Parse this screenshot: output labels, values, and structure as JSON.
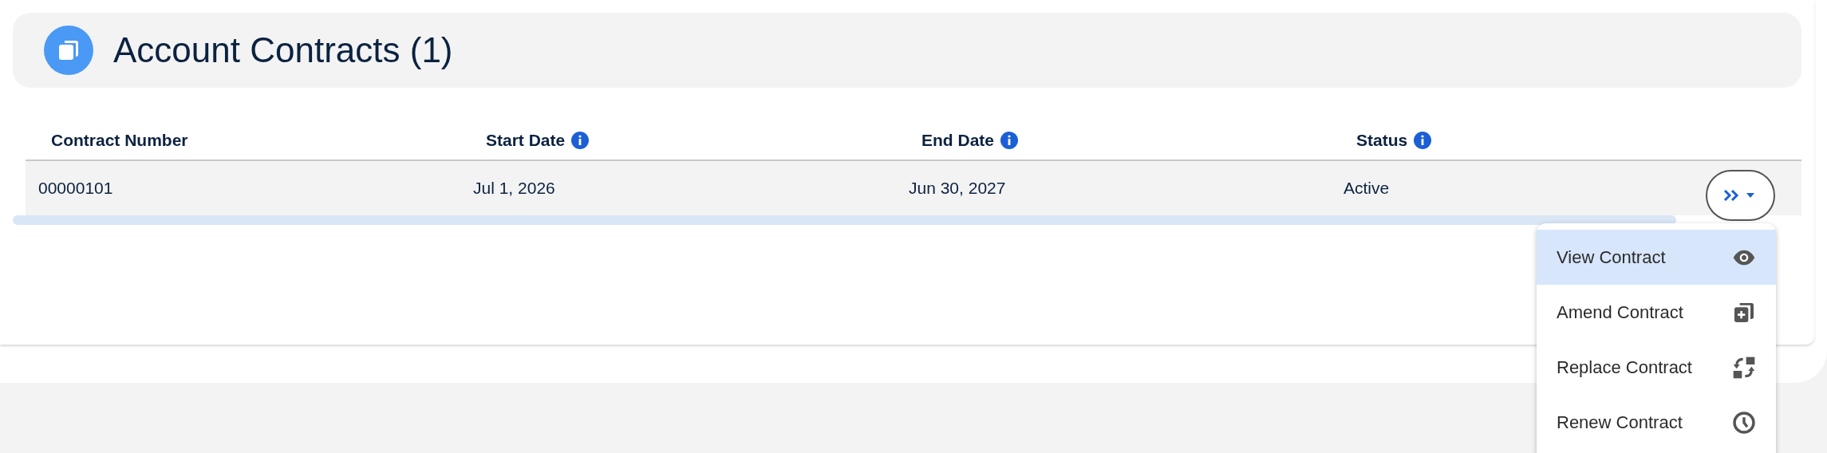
{
  "header": {
    "title": "Account Contracts (1)"
  },
  "table": {
    "columns": [
      {
        "label": "Contract Number",
        "info": false
      },
      {
        "label": "Start Date",
        "info": true
      },
      {
        "label": "End Date",
        "info": true
      },
      {
        "label": "Status",
        "info": true
      }
    ],
    "rows": [
      {
        "cells": [
          "00000101",
          "Jul 1, 2026",
          "Jun 30, 2027",
          "Active"
        ]
      }
    ]
  },
  "action_menu": {
    "expanded": true,
    "items": [
      {
        "label": "View Contract",
        "kind": "view",
        "selected": true
      },
      {
        "label": "Amend Contract",
        "kind": "amend",
        "selected": false
      },
      {
        "label": "Replace Contract",
        "kind": "replace",
        "selected": false
      },
      {
        "label": "Renew Contract",
        "kind": "renew",
        "selected": false
      }
    ]
  }
}
